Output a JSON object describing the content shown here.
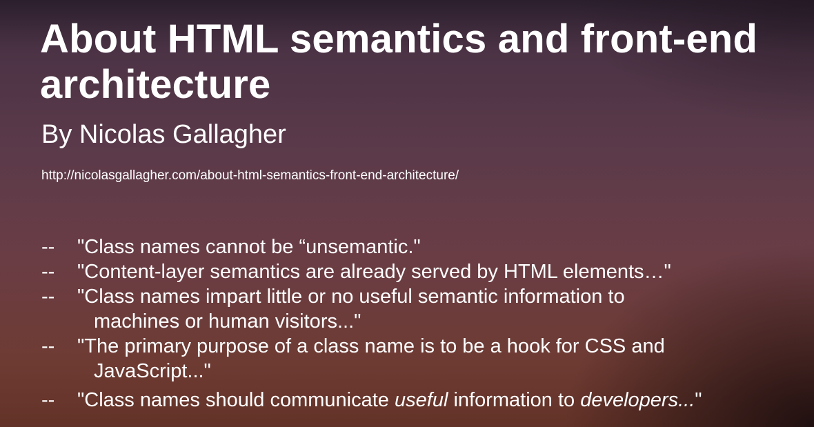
{
  "slide": {
    "title": "About HTML semantics and front-end architecture",
    "author": "By Nicolas Gallagher",
    "url": "http://nicolasgallagher.com/about-html-semantics-front-end-architecture/",
    "dash": "--",
    "quotes": [
      {
        "text": "\"Class names cannot be “unsemantic.\""
      },
      {
        "text": "\"Content-layer semantics are already served by HTML elements…\""
      },
      {
        "line1": "\"Class names impart little or no useful semantic information to",
        "line2": "machines or human visitors...\""
      },
      {
        "line1": "\"The primary purpose of a class name is to be a hook for CSS and",
        "line2": "JavaScript...\""
      },
      {
        "part1": "\"Class names should communicate ",
        "em1": "useful",
        "part2": " information to ",
        "em2": "developers...",
        "part3": "\""
      }
    ]
  },
  "colors": {
    "text": "#ffffff",
    "background_top": "#2b1f2d",
    "background_bottom": "#633227"
  }
}
